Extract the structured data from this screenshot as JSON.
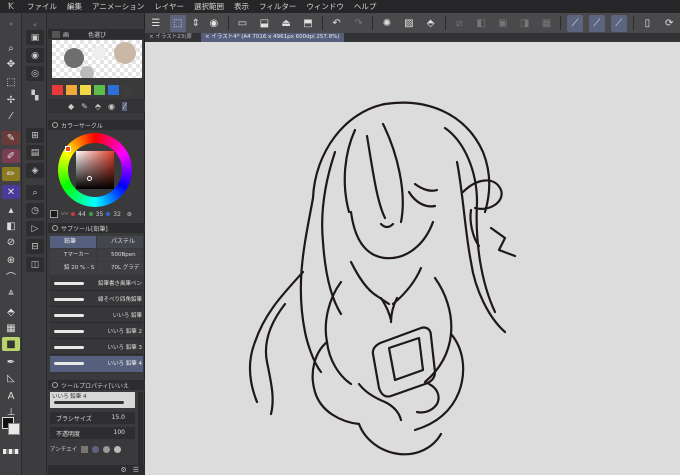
{
  "menu": {
    "logo": "Ꝁ",
    "items": [
      "ファイル",
      "編集",
      "アニメーション",
      "レイヤー",
      "選択範囲",
      "表示",
      "フィルター",
      "ウィンドウ",
      "ヘルプ"
    ]
  },
  "panel_tabs": {
    "navigator": "画",
    "color_set": "色選び",
    "color_circle": "カラーサークル",
    "sub_tool": "サブツール[鉛筆]",
    "tool_property": "ツールプロパティ[いいえ"
  },
  "color_circle": {
    "hue_value": "44",
    "sat_value": "35",
    "bright_value": "32"
  },
  "sub_tool_tabs": [
    "鉛筆",
    "パステル"
  ],
  "sub_tool_groups": [
    "Tマーカー",
    "500Bpen",
    "鉛 20 % - S",
    "70L グラデ"
  ],
  "brushes": [
    "鉛筆書き風筆ペン",
    "線そべり四角鉛筆",
    "いいろ 鉛筆",
    "いいろ 鉛筆 2",
    "いいろ 鉛筆 3",
    "いいろ 鉛筆 4"
  ],
  "tool_property": {
    "preset_name": "いいろ 鉛筆 4",
    "brush_size_label": "ブラシサイズ",
    "brush_size_value": "15.0",
    "opacity_label": "不透明度",
    "opacity_value": "100",
    "antialias_label": "アンチエイ"
  },
  "doc_tabs": {
    "tab1": "イラスト23(原",
    "tab2": "イラスト4* (A4 7016 x 4961px 600dpi 257.8%)"
  },
  "colors": {
    "accent": "#5c6480",
    "canvas_bg": "#dcdcdc",
    "stroke": "#1e1816",
    "swatches": [
      "#e63a3a",
      "#f0a838",
      "#f1d846",
      "#5bbd4c",
      "#2e6fd6",
      "#3c3c3c"
    ]
  },
  "icons": {
    "tools": [
      "zoom-icon",
      "move-icon",
      "hand-icon",
      "select-icon",
      "eyedropper-icon",
      "pen-icon",
      "pencil-icon",
      "brush-icon",
      "airbrush-icon",
      "eraser-icon",
      "fill-icon",
      "gradient-icon",
      "shape-icon",
      "text-icon",
      "ruler-icon"
    ]
  }
}
